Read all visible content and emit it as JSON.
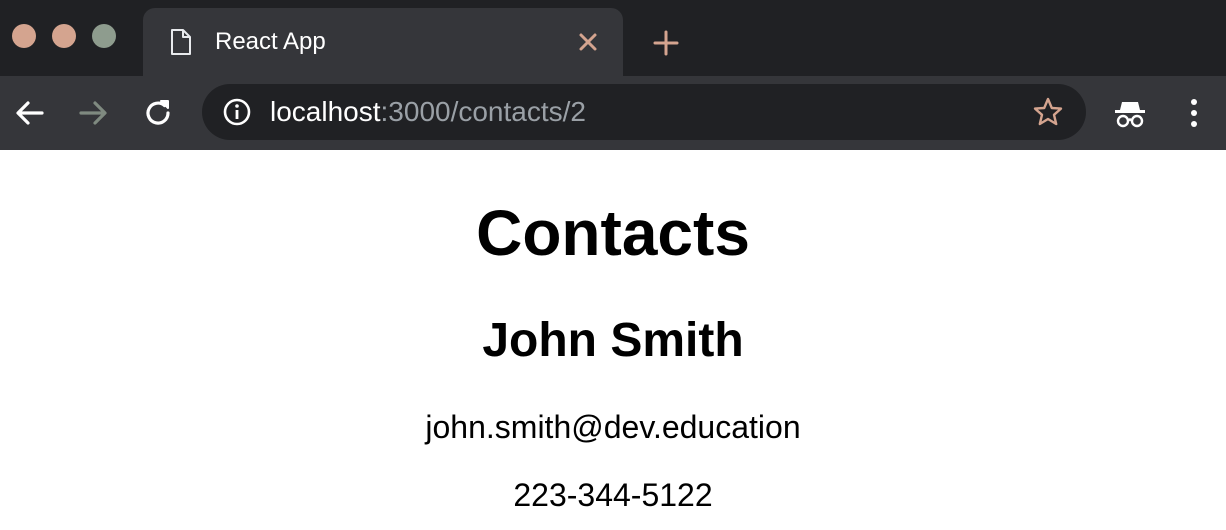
{
  "browser": {
    "tab": {
      "title": "React App",
      "icon": "document-icon"
    },
    "address": {
      "host": "localhost",
      "path": ":3000/contacts/2"
    },
    "colors": {
      "chrome_dark": "#202124",
      "chrome_toolbar": "#35363a",
      "url_dim": "#9aa0a6"
    }
  },
  "page": {
    "heading": "Contacts",
    "contact": {
      "name": "John Smith",
      "email": "john.smith@dev.education",
      "phone": "223-344-5122"
    }
  }
}
